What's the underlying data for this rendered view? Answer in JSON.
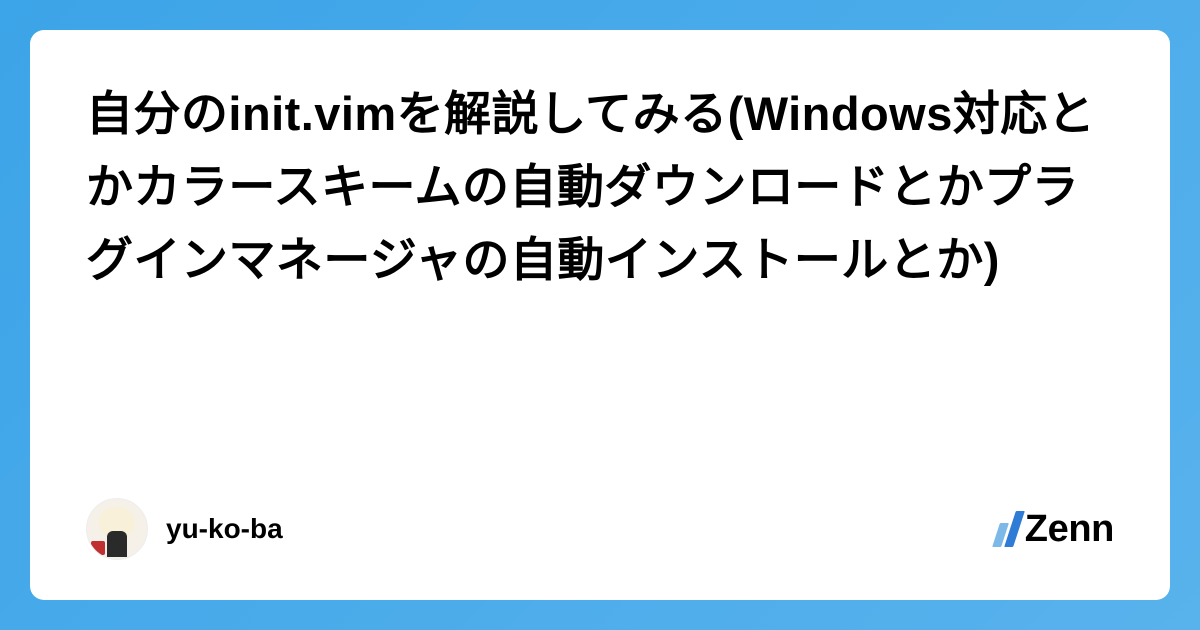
{
  "article": {
    "title": "自分のinit.vimを解説してみる(Windows対応とかカラースキームの自動ダウンロードとかプラグインマネージャの自動インストールとか)"
  },
  "author": {
    "name": "yu-ko-ba"
  },
  "platform": {
    "name": "Zenn"
  }
}
